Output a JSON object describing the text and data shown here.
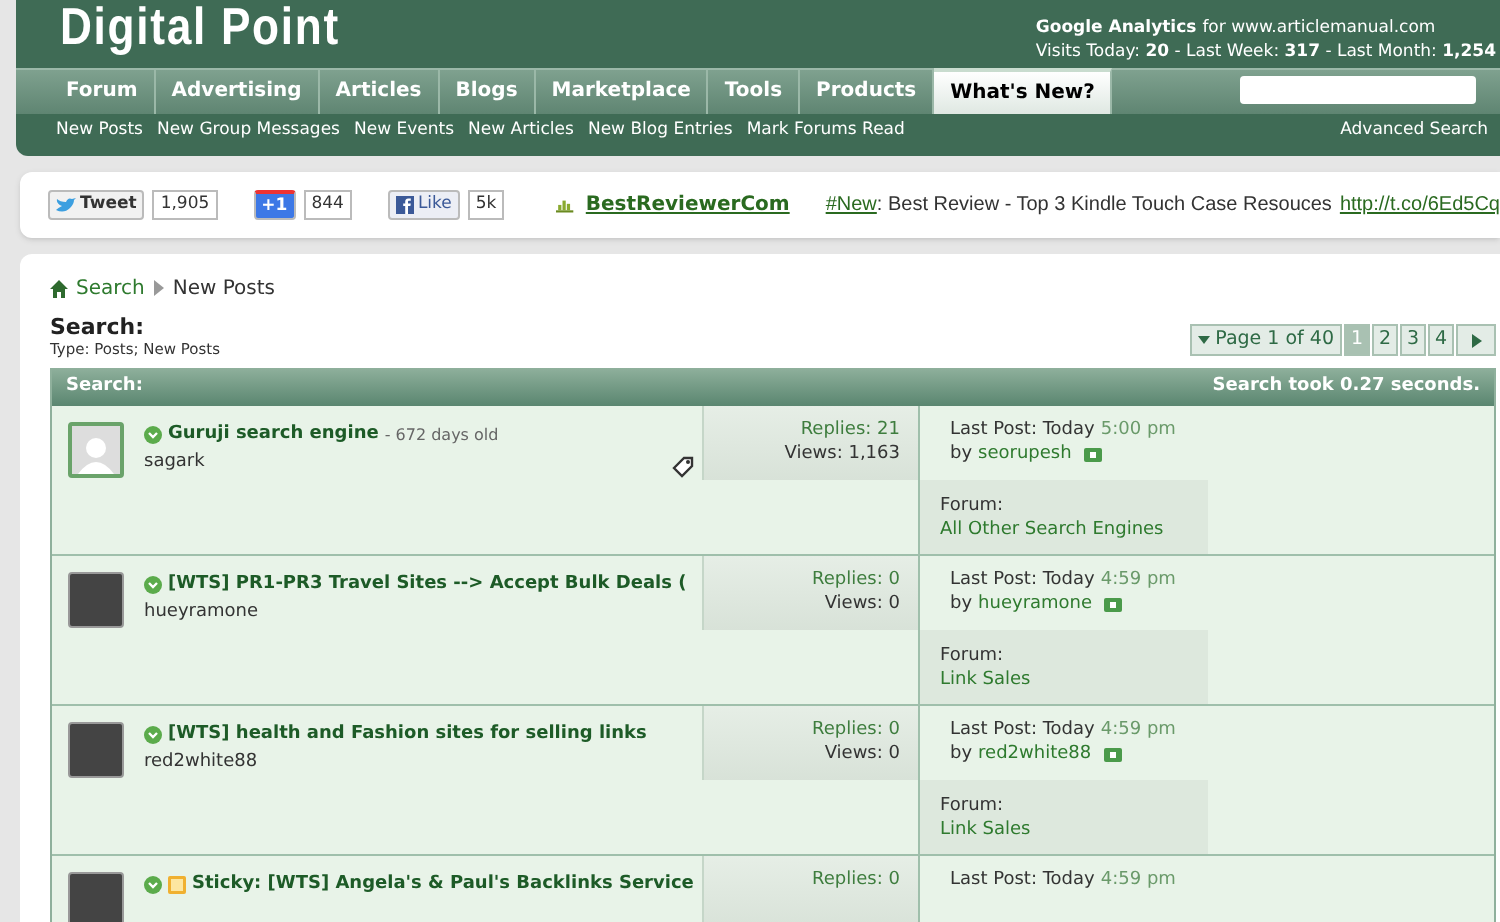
{
  "header": {
    "logo": "Digital Point",
    "analytics": {
      "title": "Google Analytics",
      "site": "for www.articlemanual.com",
      "stats": "Visits Today: **20** - Last Week: **317** - Last Month: **1,254**"
    }
  },
  "nav": {
    "tabs": [
      {
        "label": "Forum",
        "selected": false
      },
      {
        "label": "Advertising",
        "selected": false
      },
      {
        "label": "Articles",
        "selected": false
      },
      {
        "label": "Blogs",
        "selected": false
      },
      {
        "label": "Marketplace",
        "selected": false
      },
      {
        "label": "Tools",
        "selected": false
      },
      {
        "label": "Products",
        "selected": false
      },
      {
        "label": "What's New?",
        "selected": true
      }
    ],
    "sub_links": [
      "New Posts",
      "New Group Messages",
      "New Events",
      "New Articles",
      "New Blog Entries",
      "Mark Forums Read"
    ],
    "advanced_search": "Advanced Search"
  },
  "social": {
    "tweet": {
      "label": "Tweet",
      "count": "1,905"
    },
    "plus": {
      "label": "+1",
      "count": "844"
    },
    "like": {
      "label": "Like",
      "count": "5k"
    },
    "account": "BestReviewerCom",
    "hashtag": "#New",
    "message": ": Best Review - Top 3 Kindle Touch Case Resouces",
    "url": "http://t.co/6Ed5Cq"
  },
  "breadcrumb": [
    "Search",
    "New Posts"
  ],
  "search": {
    "title": "Search:",
    "type": "Type: Posts; New Posts"
  },
  "pagination": {
    "label": "Page 1 of 40",
    "pages": [
      {
        "label": "1",
        "selected": true
      },
      {
        "label": "2",
        "selected": false
      },
      {
        "label": "3",
        "selected": false
      },
      {
        "label": "4",
        "selected": false
      }
    ]
  },
  "results": {
    "title": "Search:",
    "time": "Search took 0.27 seconds.",
    "rows": [
      {
        "kind": "placeholder",
        "title": "Guruji search engine",
        "age": "- 672 days old",
        "user": "sagark",
        "tagged": true,
        "sticky": false,
        "replies": "Replies: 21",
        "views": "Views: 1,163",
        "last_post": "Last Post: Today",
        "last_post_time": "5:00 pm",
        "by": "by",
        "last_user": "seorupesh",
        "forum_label": "Forum:",
        "forum": "All Other Search Engines"
      },
      {
        "kind": "photo",
        "title": "[WTS] PR1-PR3 Travel Sites --> Accept Bulk Deals (",
        "user": "hueyramone",
        "tagged": false,
        "sticky": false,
        "replies": "Replies: 0",
        "views": "Views: 0",
        "last_post": "Last Post: Today",
        "last_post_time": "4:59 pm",
        "by": "by",
        "last_user": "hueyramone",
        "forum_label": "Forum:",
        "forum": "Link Sales"
      },
      {
        "kind": "photo",
        "title": "[WTS] health and Fashion sites for selling links",
        "user": "red2white88",
        "tagged": false,
        "sticky": false,
        "replies": "Replies: 0",
        "views": "Views: 0",
        "last_post": "Last Post: Today",
        "last_post_time": "4:59 pm",
        "by": "by",
        "last_user": "red2white88",
        "forum_label": "Forum:",
        "forum": "Link Sales"
      },
      {
        "kind": "photo",
        "title": "Sticky: [WTS] Angela's & Paul's Backlinks Service",
        "tagged": false,
        "sticky": true,
        "replies": "Replies: 0",
        "last_post": "Last Post: Today",
        "last_post_time": "4:59 pm"
      }
    ]
  }
}
